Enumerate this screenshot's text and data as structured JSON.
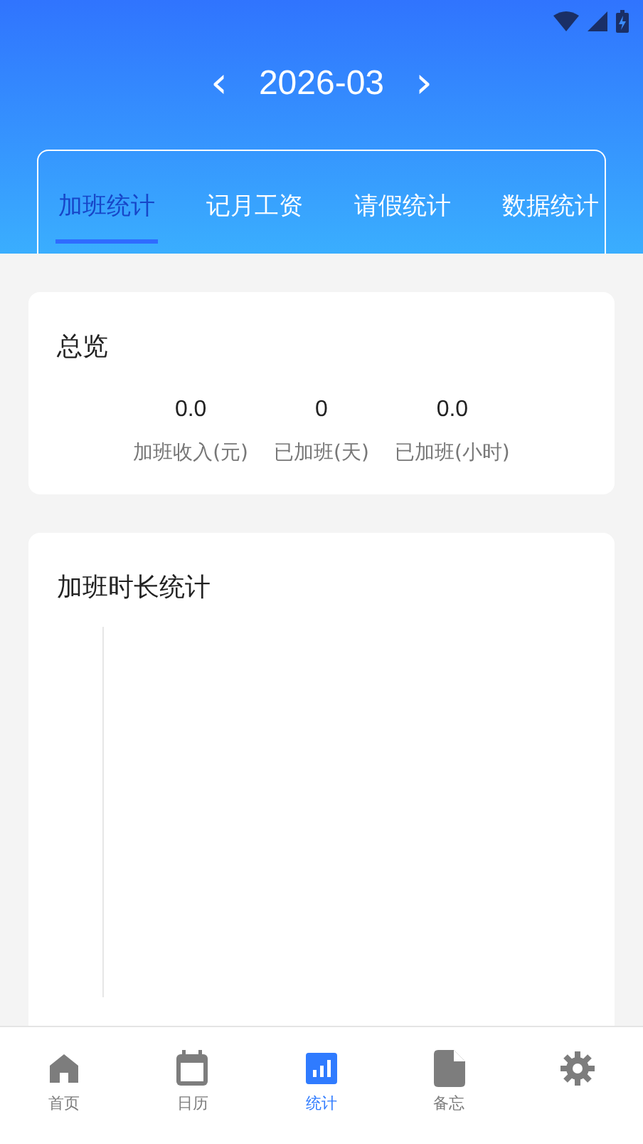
{
  "month_nav": {
    "prev": "‹",
    "month": "2026-03",
    "next": "›"
  },
  "tabs": [
    {
      "label": "加班统计",
      "selected": true
    },
    {
      "label": "记月工资",
      "selected": false
    },
    {
      "label": "请假统计",
      "selected": false
    },
    {
      "label": "数据统计",
      "selected": false
    }
  ],
  "overview": {
    "title": "总览",
    "stats": [
      {
        "value": "0.0",
        "label": "加班收入(元)"
      },
      {
        "value": "0",
        "label": "已加班(天)"
      },
      {
        "value": "0.0",
        "label": "已加班(小时)"
      }
    ]
  },
  "duration_card": {
    "title": "加班时长统计"
  },
  "bottom_nav": [
    {
      "kind": "home",
      "label": "首页",
      "selected": false
    },
    {
      "kind": "calendar",
      "label": "日历",
      "selected": false
    },
    {
      "kind": "stats",
      "label": "统计",
      "selected": true
    },
    {
      "kind": "memo",
      "label": "备忘",
      "selected": false
    },
    {
      "kind": "settings",
      "selected": false
    }
  ]
}
